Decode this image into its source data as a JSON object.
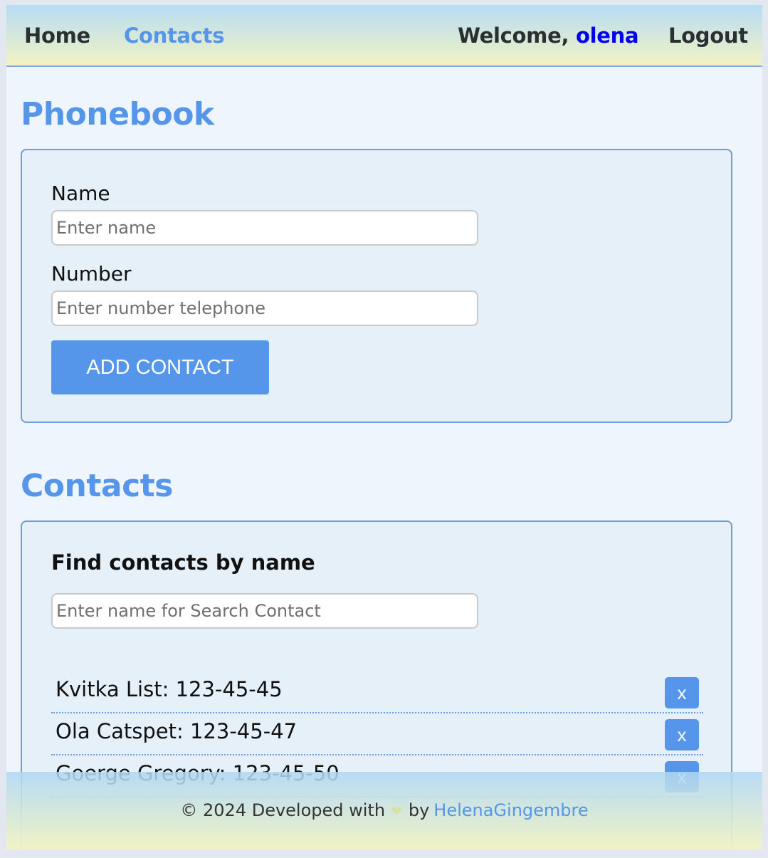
{
  "header": {
    "nav": {
      "home": "Home",
      "contacts": "Contacts"
    },
    "welcome_prefix": "Welcome, ",
    "username": "olena",
    "logout": "Logout"
  },
  "phonebook": {
    "title": "Phonebook",
    "name_label": "Name",
    "name_placeholder": "Enter name",
    "number_label": "Number",
    "number_placeholder": "Enter number telephone",
    "add_button": "ADD CONTACT"
  },
  "contacts": {
    "title": "Contacts",
    "find_title": "Find contacts by name",
    "search_placeholder": "Enter name for Search Contact",
    "delete_label": "x",
    "items": [
      {
        "text": "Kvitka List: 123-45-45"
      },
      {
        "text": "Ola Catspet: 123-45-47"
      },
      {
        "text": "Goerge Gregory: 123-45-50"
      }
    ]
  },
  "footer": {
    "prefix": "© 2024 Developed with",
    "heart": "❤",
    "by": "by",
    "author": "HelenaGingembre"
  },
  "colors": {
    "accent": "#5596ea",
    "username": "#0000ee",
    "card_border": "#6e9ed9"
  }
}
